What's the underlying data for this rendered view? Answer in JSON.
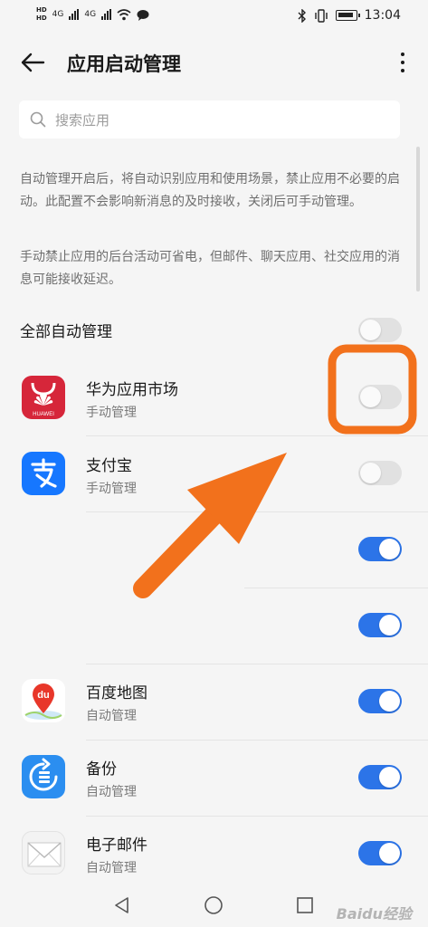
{
  "status_bar": {
    "hd1": "HD",
    "hd2": "HD",
    "net1": "4G",
    "net2": "4G",
    "time": "13:04",
    "icons": [
      "hd-icon",
      "signal-icon",
      "wifi-icon",
      "chat-icon",
      "bluetooth-icon",
      "vibrate-icon",
      "battery-icon"
    ]
  },
  "header": {
    "title": "应用启动管理",
    "back_icon": "arrow-left-icon",
    "more_icon": "more-vertical-icon"
  },
  "search": {
    "placeholder": "搜索应用",
    "icon": "search-icon"
  },
  "description": {
    "paragraph1": "自动管理开启后，将自动识别应用和使用场景，禁止应用不必要的启动。此配置不会影响新消息的及时接收，关闭后可手动管理。",
    "paragraph2": "手动禁止应用的后台活动可省电，但邮件、聊天应用、社交应用的消息可能接收延迟。"
  },
  "all_auto": {
    "label": "全部自动管理",
    "on": false
  },
  "apps": [
    {
      "name": "华为应用市场",
      "status": "手动管理",
      "on": false,
      "icon": "huawei-appgallery-icon",
      "icon_label": "HUAWEI",
      "highlighted": true
    },
    {
      "name": "支付宝",
      "status": "手动管理",
      "on": false,
      "icon": "alipay-icon"
    },
    {
      "name": "",
      "status": "",
      "on": true,
      "icon": ""
    },
    {
      "name": "",
      "status": "",
      "on": true,
      "icon": ""
    },
    {
      "name": "百度地图",
      "status": "自动管理",
      "on": true,
      "icon": "baidu-map-icon",
      "icon_label": "du"
    },
    {
      "name": "备份",
      "status": "自动管理",
      "on": true,
      "icon": "backup-icon"
    },
    {
      "name": "电子邮件",
      "status": "自动管理",
      "on": true,
      "icon": "email-icon"
    }
  ],
  "annotation": {
    "arrow_color": "#f2711c",
    "box_color": "#f2711c"
  },
  "colors": {
    "toggle_on": "#2c74e8",
    "toggle_off": "#e1e1e1",
    "background": "#f5f5f5"
  },
  "nav": {
    "back_icon": "triangle-back-icon",
    "home_icon": "circle-home-icon",
    "recents_icon": "square-recents-icon"
  },
  "watermark": "Baidu经验"
}
